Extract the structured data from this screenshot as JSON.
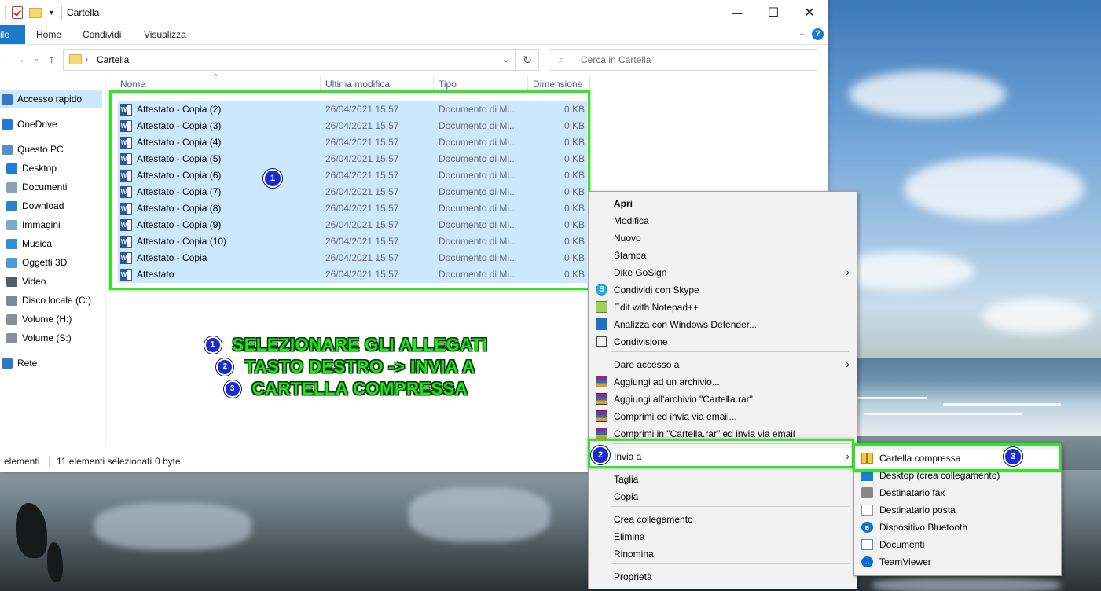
{
  "window": {
    "title": "Cartella",
    "controls": {
      "minimize": "—",
      "maximize": "☐",
      "close": "✕"
    }
  },
  "ribbon": {
    "file": "ile",
    "tabs": [
      "Home",
      "Condividi",
      "Visualizza"
    ],
    "help": "?"
  },
  "address": {
    "path": "Cartella",
    "search_placeholder": "Cerca in Cartella"
  },
  "nav": {
    "items": [
      {
        "label": "Accesso rapido",
        "icon": "star-icon",
        "color": "#2f77c8"
      },
      {
        "label": "OneDrive",
        "icon": "cloud-icon",
        "color": "#1e7ad6"
      },
      {
        "label": "Questo PC",
        "icon": "computer-icon",
        "color": "#5a8ec9"
      },
      {
        "label": "Desktop",
        "icon": "desktop-icon",
        "color": "#1a7fd6"
      },
      {
        "label": "Documenti",
        "icon": "documents-icon",
        "color": "#8aa0b8"
      },
      {
        "label": "Download",
        "icon": "download-icon",
        "color": "#2a7fd0"
      },
      {
        "label": "Immagini",
        "icon": "images-icon",
        "color": "#7ea7cc"
      },
      {
        "label": "Musica",
        "icon": "music-icon",
        "color": "#2f8fd8"
      },
      {
        "label": "Oggetti 3D",
        "icon": "objects-3d-icon",
        "color": "#4a9ad8"
      },
      {
        "label": "Video",
        "icon": "video-icon",
        "color": "#555c66"
      },
      {
        "label": "Disco locale (C:)",
        "icon": "drive-c-icon",
        "color": "#7d8894"
      },
      {
        "label": "Volume (H:)",
        "icon": "drive-icon",
        "color": "#8a8f96"
      },
      {
        "label": "Volume (S:)",
        "icon": "drive-icon",
        "color": "#8a8f96"
      },
      {
        "label": "Rete",
        "icon": "network-icon",
        "color": "#2f77c8"
      }
    ]
  },
  "columns": {
    "name": "Nome",
    "modified": "Ultima modifica",
    "type": "Tipo",
    "size": "Dimensione"
  },
  "files": [
    {
      "name": "Attestato - Copia (2)",
      "date": "26/04/2021 15:57",
      "type": "Documento di Mi...",
      "size": "0 KB"
    },
    {
      "name": "Attestato - Copia (3)",
      "date": "26/04/2021 15:57",
      "type": "Documento di Mi...",
      "size": "0 KB"
    },
    {
      "name": "Attestato - Copia (4)",
      "date": "26/04/2021 15:57",
      "type": "Documento di Mi...",
      "size": "0 KB"
    },
    {
      "name": "Attestato - Copia (5)",
      "date": "26/04/2021 15:57",
      "type": "Documento di Mi...",
      "size": "0 KB"
    },
    {
      "name": "Attestato - Copia (6)",
      "date": "26/04/2021 15:57",
      "type": "Documento di Mi...",
      "size": "0 KB"
    },
    {
      "name": "Attestato - Copia (7)",
      "date": "26/04/2021 15:57",
      "type": "Documento di Mi...",
      "size": "0 KB"
    },
    {
      "name": "Attestato - Copia (8)",
      "date": "26/04/2021 15:57",
      "type": "Documento di Mi...",
      "size": "0 KB"
    },
    {
      "name": "Attestato - Copia (9)",
      "date": "26/04/2021 15:57",
      "type": "Documento di Mi...",
      "size": "0 KB"
    },
    {
      "name": "Attestato - Copia (10)",
      "date": "26/04/2021 15:57",
      "type": "Documento di Mi...",
      "size": "0 KB"
    },
    {
      "name": "Attestato - Copia",
      "date": "26/04/2021 15:57",
      "type": "Documento di Mi...",
      "size": "0 KB"
    },
    {
      "name": "Attestato",
      "date": "26/04/2021 15:57",
      "type": "Documento di Mi...",
      "size": "0 KB"
    }
  ],
  "status": {
    "count": "elementi",
    "selected": "11 elementi selezionati",
    "bytes": "0 byte"
  },
  "instructions": {
    "badges": [
      "1",
      "2",
      "3"
    ],
    "lines": [
      "SELEZIONARE GLI ALLEGATI",
      "TASTO DESTRO -> INVIA A",
      "CARTELLA COMPRESSA"
    ]
  },
  "context_menu": {
    "items": [
      {
        "label": "Apri",
        "bold": true
      },
      {
        "label": "Modifica"
      },
      {
        "label": "Nuovo"
      },
      {
        "label": "Stampa"
      },
      {
        "label": "Dike GoSign",
        "submenu": true
      },
      {
        "label": "Condividi con Skype",
        "icon": "skype-icon"
      },
      {
        "label": "Edit with Notepad++",
        "icon": "notepad-plus-plus-icon"
      },
      {
        "label": "Analizza con Windows Defender...",
        "icon": "windows-defender-icon"
      },
      {
        "label": "Condivisione",
        "icon": "share-icon"
      },
      {
        "label": "Dare accesso a",
        "submenu": true
      },
      {
        "label": "Aggiungi ad un archivio...",
        "icon": "winrar-icon"
      },
      {
        "label": "Aggiungi all'archivio \"Cartella.rar\"",
        "icon": "winrar-icon"
      },
      {
        "label": "Comprimi ed invia via email...",
        "icon": "winrar-icon"
      },
      {
        "label": "Comprimi in \"Cartella.rar\" ed invia via email",
        "icon": "winrar-icon"
      },
      {
        "label": "Invia a",
        "submenu": true
      },
      {
        "label": "Taglia"
      },
      {
        "label": "Copia"
      },
      {
        "label": "Crea collegamento"
      },
      {
        "label": "Elimina"
      },
      {
        "label": "Rinomina"
      },
      {
        "label": "Proprietà"
      }
    ],
    "submenu_arrow": "›"
  },
  "send_to": {
    "items": [
      {
        "label": "Cartella compressa",
        "icon": "zip-folder-icon"
      },
      {
        "label": "Desktop (crea collegamento)",
        "icon": "desktop-icon"
      },
      {
        "label": "Destinatario fax",
        "icon": "fax-icon"
      },
      {
        "label": "Destinatario posta",
        "icon": "mail-icon"
      },
      {
        "label": "Dispositivo Bluetooth",
        "icon": "bluetooth-icon"
      },
      {
        "label": "Documenti",
        "icon": "documents-icon"
      },
      {
        "label": "TeamViewer",
        "icon": "teamviewer-icon"
      }
    ]
  },
  "colors": {
    "highlight": "#37e22a",
    "badge": "#1a2ccf",
    "selection": "#cce8ff",
    "accent": "#1979ca"
  }
}
